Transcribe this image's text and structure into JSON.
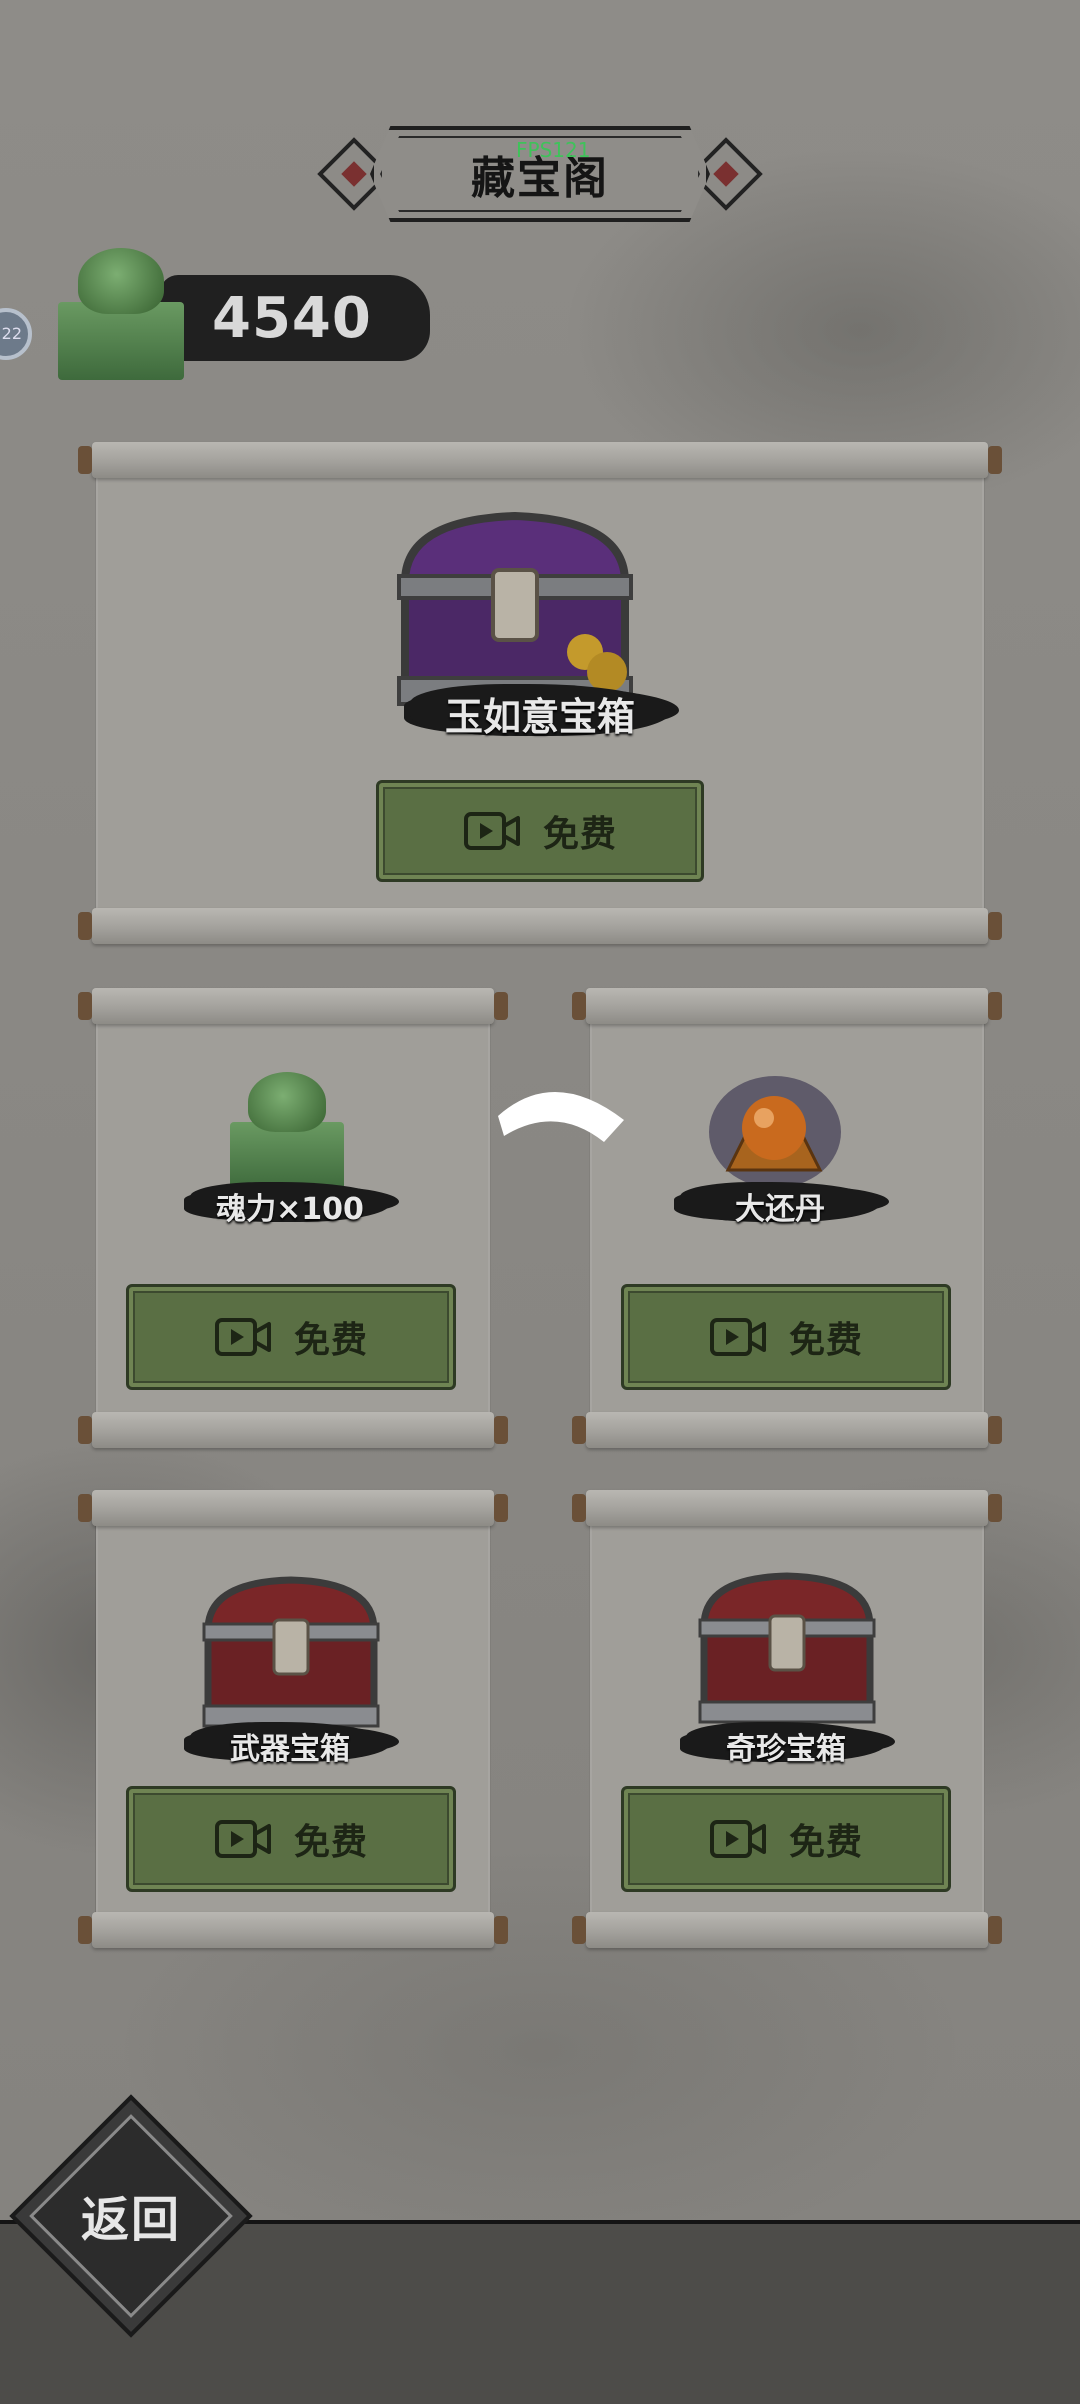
{
  "header": {
    "title": "藏宝阁",
    "fps": "FPS121"
  },
  "player": {
    "avatar_level": "22"
  },
  "currency": {
    "icon": "jade-seal-icon",
    "amount": "4540"
  },
  "main_reward": {
    "name": "玉如意宝箱",
    "button_label": "免费",
    "button_icon": "video-icon"
  },
  "rewards": [
    {
      "name": "魂力×100",
      "button_label": "免费",
      "icon": "jade-seal-icon"
    },
    {
      "name": "大还丹",
      "button_label": "免费",
      "icon": "elixir-pill-icon"
    },
    {
      "name": "武器宝箱",
      "button_label": "免费",
      "icon": "red-chest-icon"
    },
    {
      "name": "奇珍宝箱",
      "button_label": "免费",
      "icon": "red-chest-icon"
    }
  ],
  "footer": {
    "back_label": "返回"
  },
  "colors": {
    "button_green": "#5a6f44",
    "paper": "#a09e99",
    "background": "#8b8985"
  }
}
